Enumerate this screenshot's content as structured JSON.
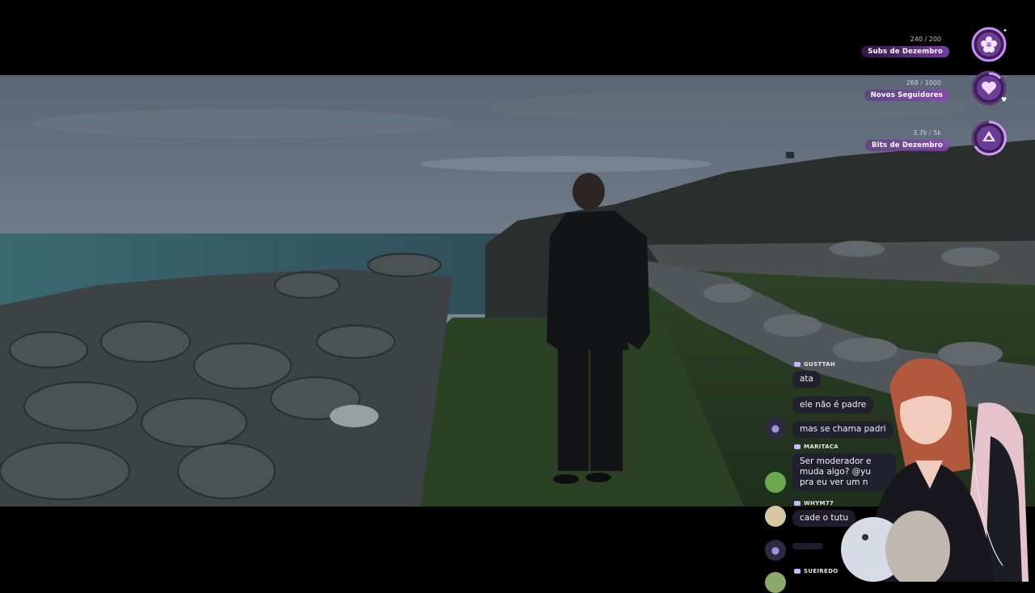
{
  "goals": [
    {
      "count": "240 / 200",
      "label": "Subs de Dezembro",
      "icon": "flower-icon"
    },
    {
      "count": "268 / 1000",
      "label": "Novos Seguidores",
      "icon": "heart-icon"
    },
    {
      "count": "3.7k / 5k",
      "label": "Bits de Dezembro",
      "icon": "gem-icon"
    }
  ],
  "chat": {
    "messages": [
      {
        "user": "GUSTTAH",
        "lines": [
          "ata"
        ]
      },
      {
        "user": "",
        "lines": [
          "ele não é padre"
        ]
      },
      {
        "user": "",
        "lines": [
          "mas se chama padri"
        ]
      },
      {
        "user": "MARITACA",
        "lines": [
          "Ser moderador e",
          "muda algo? @yu",
          "pra eu ver um n"
        ]
      },
      {
        "user": "WHYM77",
        "lines": [
          "cade o tutu"
        ]
      },
      {
        "user": "SUEIREDO",
        "lines": [
          ""
        ]
      }
    ]
  },
  "colors": {
    "accent": "#b77cf2",
    "bubble": "#221e30"
  }
}
